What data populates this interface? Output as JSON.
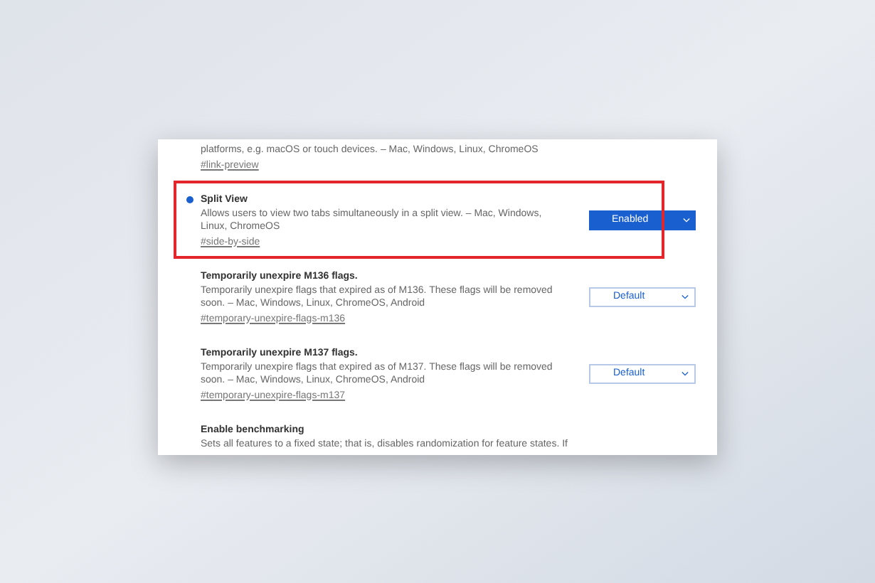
{
  "flags": [
    {
      "description": "platforms, e.g. macOS or touch devices. – Mac, Windows, Linux, ChromeOS",
      "link": "#link-preview",
      "highlighted": false
    },
    {
      "title": "Split View",
      "description": "Allows users to view two tabs simultaneously in a split view. – Mac, Windows, Linux, ChromeOS",
      "link": "#side-by-side",
      "value": "Enabled",
      "modified": true,
      "highlighted": true
    },
    {
      "title": "Temporarily unexpire M136 flags.",
      "description": "Temporarily unexpire flags that expired as of M136. These flags will be removed soon. – Mac, Windows, Linux, ChromeOS, Android",
      "link": "#temporary-unexpire-flags-m136",
      "value": "Default",
      "modified": false,
      "highlighted": false
    },
    {
      "title": "Temporarily unexpire M137 flags.",
      "description": "Temporarily unexpire flags that expired as of M137. These flags will be removed soon. – Mac, Windows, Linux, ChromeOS, Android",
      "link": "#temporary-unexpire-flags-m137",
      "value": "Default",
      "modified": false,
      "highlighted": false
    },
    {
      "title": "Enable benchmarking",
      "description": "Sets all features to a fixed state; that is, disables randomization for feature states. If",
      "highlighted": false
    }
  ]
}
